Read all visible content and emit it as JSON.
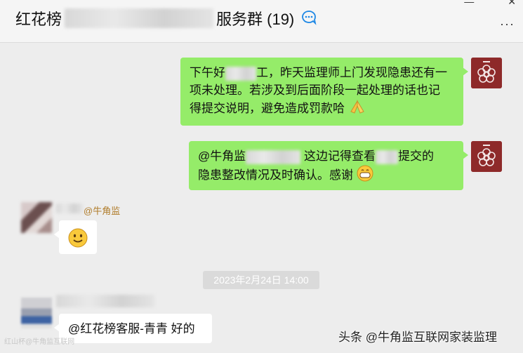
{
  "header": {
    "title_prefix": "红花榜",
    "title_suffix": "服务群 (19)"
  },
  "window": {
    "minimize": "—",
    "close": "✕",
    "more": "···"
  },
  "messages": [
    {
      "side": "right",
      "line1a": "下午好",
      "line1b": "工，昨天监理师上门发现隐患还有一",
      "line2": "项未处理。若涉及到后面阶段一起处理的话也记",
      "line3": "得提交说明，避免造成罚款哈"
    },
    {
      "side": "right",
      "line1a": "@牛角监",
      "line1b": "这边记得查看",
      "line1c": "提交的",
      "line2": "隐患整改情况及时确认。感谢"
    },
    {
      "side": "left",
      "sender": "@牛角监"
    },
    {
      "side": "left",
      "text": "@红花榜客服-青青 好的"
    }
  ],
  "timestamp": "2023年2月24日 14:00",
  "watermark": "头条 @牛角监互联网家装监理",
  "watermark_left": "红山杯@牛角监互联网"
}
